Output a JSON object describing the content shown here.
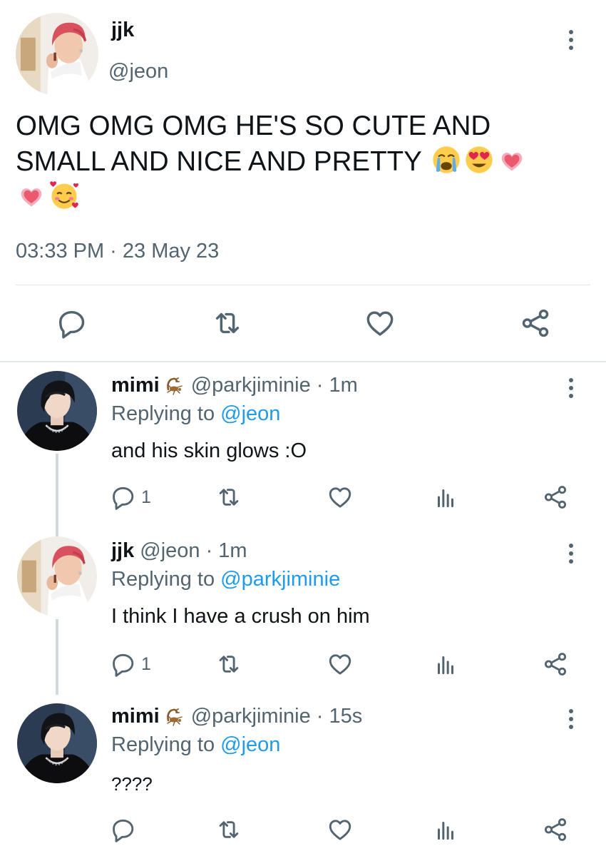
{
  "main_tweet": {
    "display_name": "jjk",
    "handle": "@jeon",
    "text": "OMG OMG OMG HE'S SO CUTE AND SMALL AND NICE AND PRETTY",
    "emojis": [
      "loudly-crying-face",
      "smiling-face-with-heart-eyes",
      "growing-heart",
      "growing-heart",
      "smiling-face-with-hearts"
    ],
    "timestamp": "03:33 PM · 23 May 23",
    "actions": [
      "reply-icon",
      "retweet-icon",
      "like-icon",
      "share-icon"
    ]
  },
  "replies": [
    {
      "display_name": "mimi",
      "name_emoji": "scorpion",
      "handle_time": "@parkjiminie · 1m",
      "replying_prefix": "Replying to",
      "replying_to": "@jeon",
      "text": "and his skin glows :O",
      "reply_count": "1"
    },
    {
      "display_name": "jjk",
      "handle_time": "@jeon · 1m",
      "replying_prefix": "Replying to",
      "replying_to": "@parkjiminie",
      "text": "I think I have a crush on him",
      "reply_count": "1"
    },
    {
      "display_name": "mimi",
      "name_emoji": "scorpion",
      "handle_time": "@parkjiminie · 15s",
      "replying_prefix": "Replying to",
      "replying_to": "@jeon",
      "text": "????",
      "reply_count": ""
    }
  ],
  "colors": {
    "text": "#0f1419",
    "secondary": "#536471",
    "mention": "#1d9bf0",
    "divider": "#e1e6ea",
    "thread_line": "#cfd9de"
  }
}
